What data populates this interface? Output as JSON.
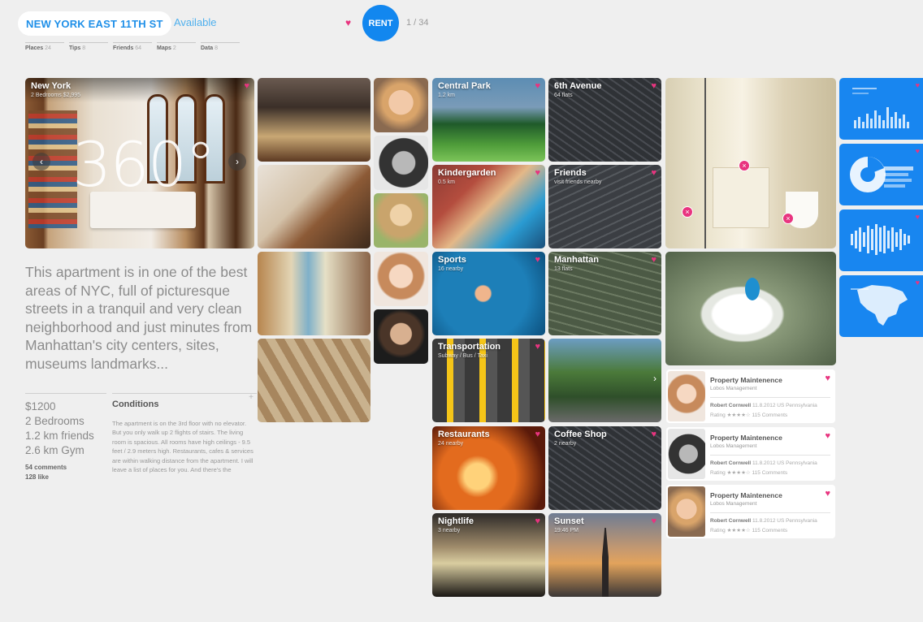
{
  "header": {
    "title": "NEW YORK EAST 11TH ST",
    "status": "Available",
    "action_label": "RENT",
    "pager": "1 / 34",
    "tabs": [
      {
        "label": "Places",
        "count": "24"
      },
      {
        "label": "Tips",
        "count": "8"
      },
      {
        "label": "Friends",
        "count": "64"
      },
      {
        "label": "Maps",
        "count": "2"
      },
      {
        "label": "Data",
        "count": "8"
      }
    ]
  },
  "hero": {
    "title": "New York",
    "subtitle": "2 Bedrooms $2,995",
    "view_label": "360°",
    "prev": "‹",
    "next": "›"
  },
  "listing": {
    "description": "This apartment is in one of the best areas of NYC, full of picturesque streets in a tranquil and very clean neighborhood and just minutes from Manhattan's city centers, sites, museums landmarks...",
    "stats": [
      "$1200",
      "2 Bedrooms",
      "1.2 km friends",
      "2.6 km Gym"
    ],
    "comments": "54 comments",
    "likes": "128 like",
    "conditions": {
      "title": "Conditions",
      "text": "The apartment is on the 3rd floor with no elevator. But you only walk up 2 flights of stairs. The living room is spacious. All rooms have high ceilings - 9.5 feet / 2.9 meters high. Restaurants, cafes & services are within walking distance from the apartment. I will leave a list of places for you. And there's the"
    }
  },
  "places": [
    {
      "title": "Central Park",
      "subtitle": "1.2 km"
    },
    {
      "title": "6th Avenue",
      "subtitle": "64 flats"
    },
    {
      "title": "Kindergarden",
      "subtitle": "0.5 km"
    },
    {
      "title": "Friends",
      "subtitle": "visit friends nearby"
    },
    {
      "title": "Sports",
      "subtitle": "16 nearby"
    },
    {
      "title": "Manhattan",
      "subtitle": "13 flats"
    },
    {
      "title": "Transportation",
      "subtitle": "Subway / Bus / Taxi"
    },
    {
      "title": "Restaurants",
      "subtitle": "24 nearby"
    },
    {
      "title": "Coffee Shop",
      "subtitle": "2 nearby"
    },
    {
      "title": "Nightlife",
      "subtitle": "3 nearby"
    },
    {
      "title": "Sunset",
      "subtitle": "19:46 PM"
    }
  ],
  "street_next": "›",
  "reviews": [
    {
      "title": "Property Maintenence",
      "company": "Lobos Management",
      "author": "Robert Cornwell",
      "date": "11.8.2012 US Pennsylvania",
      "rating": "Rating ★★★★☆ 115 Comments"
    },
    {
      "title": "Property Maintenence",
      "company": "Lobos Management",
      "author": "Robert Cornwell",
      "date": "11.8.2012 US Pennsylvania",
      "rating": "Rating ★★★★☆ 115 Comments"
    },
    {
      "title": "Property Maintenence",
      "company": "Lobos Management",
      "author": "Robert Cornwell",
      "date": "11.8.2012 US Pennsylvania",
      "rating": "Rating ★★★★☆ 115 Comments"
    }
  ],
  "icons": {
    "heart": "♥",
    "spot": "×"
  },
  "colors": {
    "accent_blue": "#1287ef",
    "heart_pink": "#e8347f",
    "title_blue": "#1e8fe8"
  }
}
